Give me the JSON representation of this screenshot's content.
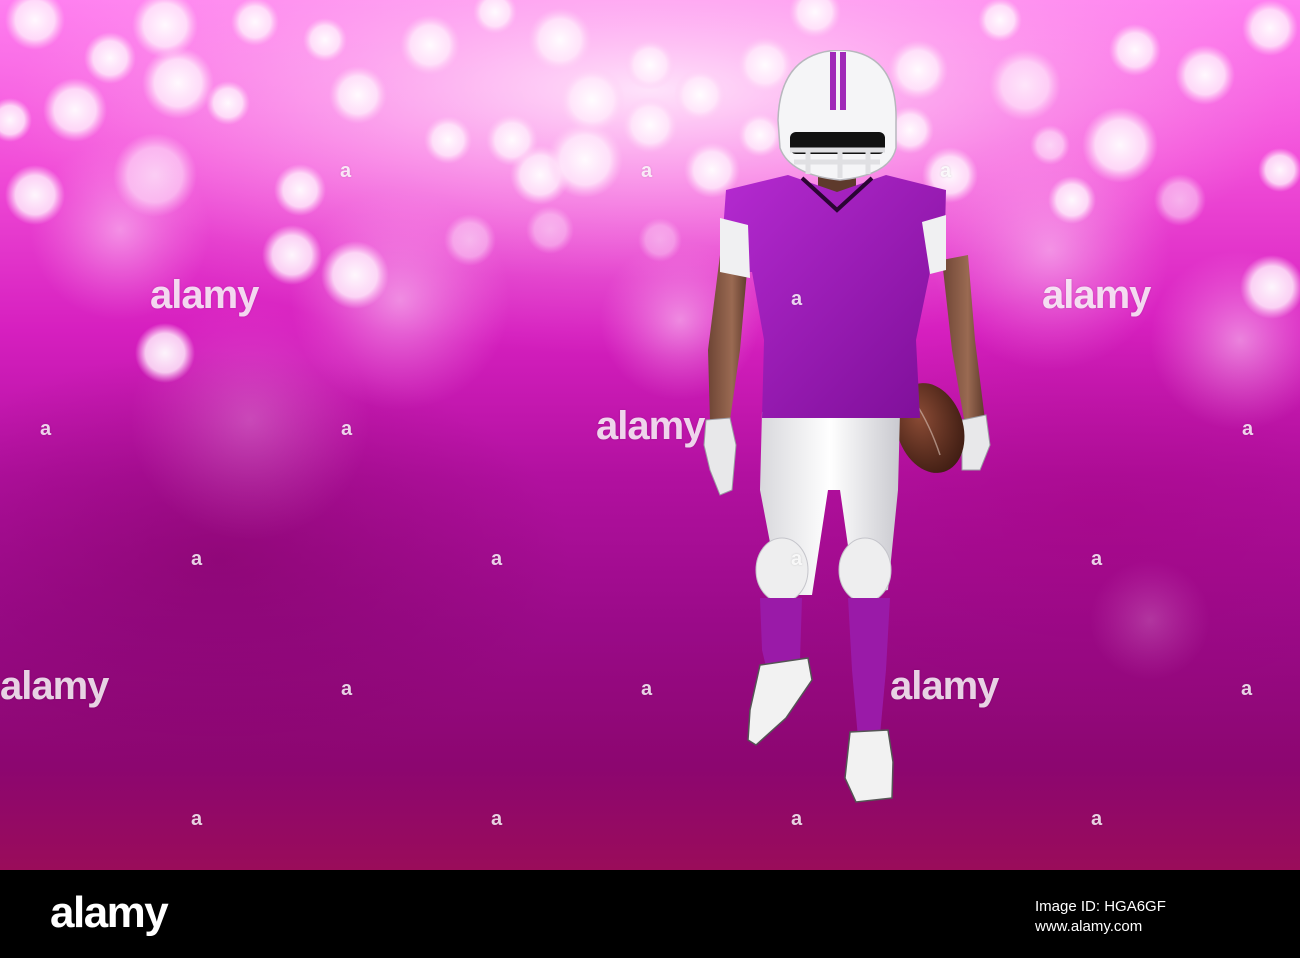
{
  "image": {
    "subject": "American football player in purple jersey holding ball",
    "background_colors": {
      "highlight": "#ffd9fb",
      "primary": "#e13ccb",
      "dark": "#8c0670"
    }
  },
  "watermark": {
    "text": "alamy",
    "small_mark": "a"
  },
  "footer": {
    "logo_text": "alamy",
    "image_id": "Image ID: HGA6GF",
    "url": "www.alamy.com"
  }
}
